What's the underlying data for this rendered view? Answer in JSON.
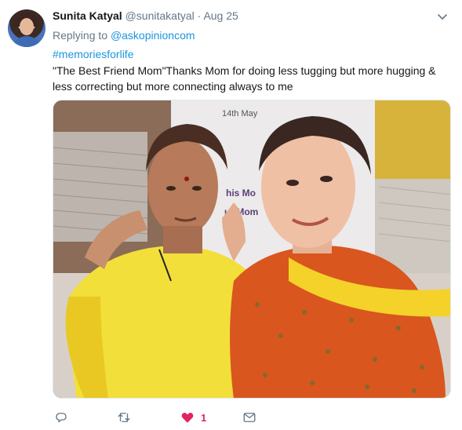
{
  "tweet": {
    "author_name": "Sunita Katyal",
    "author_handle": "@sunitakatyal",
    "separator": "·",
    "date": "Aug 25",
    "replying_prefix": "Replying to",
    "replying_to": "@askopinioncom",
    "hashtag": "#memoriesforlife",
    "text": "\"The Best Friend Mom\"Thanks Mom for doing less tugging but more hugging & less correcting but more connecting always to me",
    "media_banner_date": "14th May",
    "media_banner_line1": "his Mo",
    "media_banner_line2": "ur Mom"
  },
  "actions": {
    "reply_icon": "reply-icon",
    "retweet_icon": "retweet-icon",
    "like_icon": "heart-icon",
    "like_count": "1",
    "dm_icon": "envelope-icon"
  },
  "colors": {
    "link": "#1b95e0",
    "muted": "#657786",
    "like": "#e0245e",
    "text": "#14171a"
  }
}
